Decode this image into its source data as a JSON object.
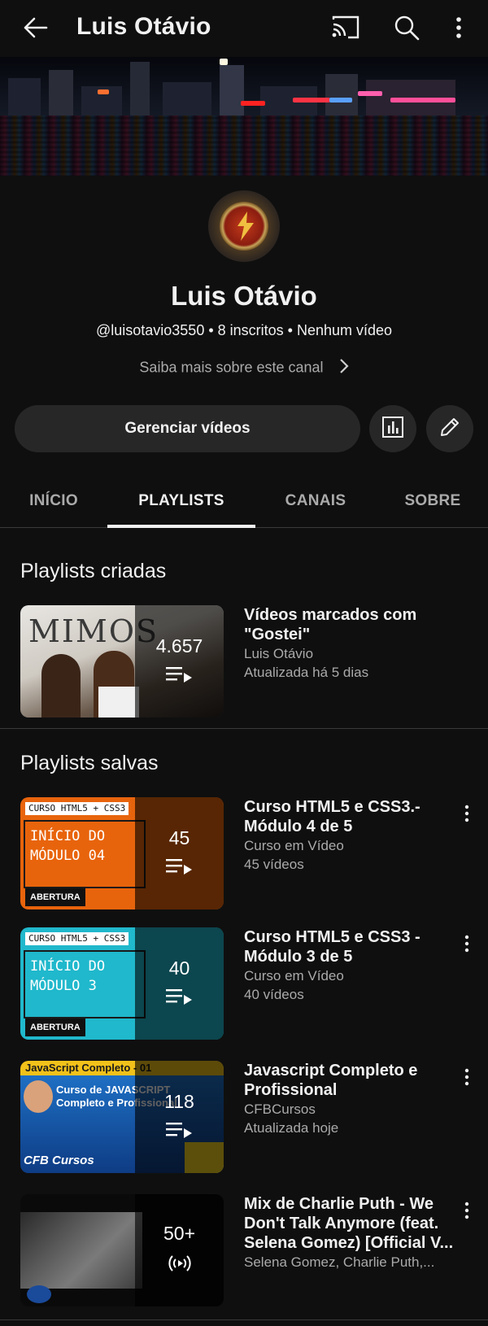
{
  "header": {
    "title": "Luis Otávio",
    "icons": [
      "back-arrow-icon",
      "cast-icon",
      "search-icon",
      "more-vert-icon"
    ]
  },
  "channel": {
    "name": "Luis Otávio",
    "meta": "@luisotavio3550 • 8 inscritos • Nenhum vídeo",
    "more_link": "Saiba mais sobre este canal"
  },
  "actions": {
    "manage_label": "Gerenciar vídeos",
    "icons": [
      "analytics-icon",
      "edit-pencil-icon"
    ]
  },
  "tabs": [
    {
      "label": "INÍCIO",
      "active": false
    },
    {
      "label": "PLAYLISTS",
      "active": true
    },
    {
      "label": "CANAIS",
      "active": false
    },
    {
      "label": "SOBRE",
      "active": false
    }
  ],
  "created": {
    "heading": "Playlists criadas",
    "items": [
      {
        "title": "Vídeos marcados com \"Gostei\"",
        "line1": "Luis Otávio",
        "line2": "Atualizada há 5 dias",
        "count": "4.657",
        "thumb_text": "MIMOS"
      }
    ]
  },
  "saved": {
    "heading": "Playlists salvas",
    "items": [
      {
        "title": "Curso HTML5 e CSS3.- Módulo 4 de 5",
        "line1": "Curso em Vídeo",
        "line2": "45 vídeos",
        "count": "45",
        "thumb_top": "CURSO HTML5 + CSS3",
        "thumb_big": "INÍCIO DO MÓDULO 04",
        "thumb_bottom": "ABERTURA",
        "accent": "#e8640c"
      },
      {
        "title": "Curso HTML5 e CSS3 - Módulo 3 de 5",
        "line1": "Curso em Vídeo",
        "line2": "40 vídeos",
        "count": "40",
        "thumb_top": "CURSO HTML5 + CSS3",
        "thumb_big": "INÍCIO DO MÓDULO 3",
        "thumb_bottom": "ABERTURA",
        "accent": "#20b8cc"
      },
      {
        "title": "Javascript Completo e Profissional",
        "line1": "CFBCursos",
        "line2": "Atualizada hoje",
        "count": "118",
        "thumb_top": "JavaScript Completo - 01",
        "thumb_big": "Curso de JAVASCRIPT Completo e Profissional",
        "thumb_bottom": "CFB Cursos",
        "accent": "#1a5aa8"
      },
      {
        "title": "Mix de Charlie Puth - We Don't Talk Anymore (feat. Selena Gomez) [Official V...",
        "line1": "Selena Gomez, Charlie Puth,...",
        "count": "50+"
      }
    ]
  },
  "colors": {
    "background": "#0f0f0f",
    "button_bg": "#272727",
    "secondary_text": "#aaaaaa"
  }
}
